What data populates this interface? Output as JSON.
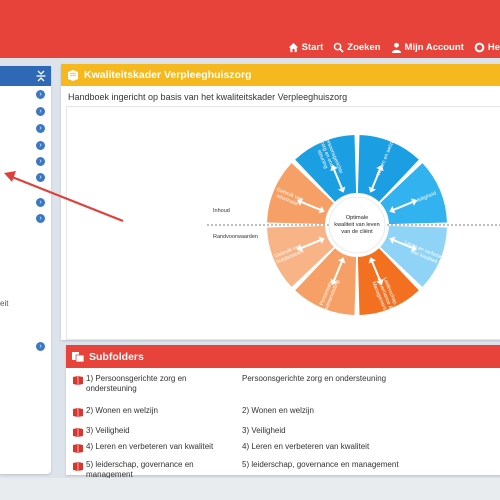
{
  "nav": [
    {
      "label": "Start",
      "icon": "home-icon"
    },
    {
      "label": "Zoeken",
      "icon": "search-icon"
    },
    {
      "label": "Mijn Account",
      "icon": "user-icon"
    },
    {
      "label": "He",
      "icon": "help-lifebuoy-icon"
    }
  ],
  "sidebar": {
    "partial_text": "eit"
  },
  "main": {
    "title": "Kwaliteitskader Verpleeghuiszorg",
    "subtitle": "Handboek ingericht op basis van het kwaliteitskader Verpleeghuiszorg",
    "diagram": {
      "center_text": [
        "Optimale",
        "kwaliteit van leven",
        "van de cliënt"
      ],
      "inhoud_label": "Inhoud",
      "rand_label": "Randvoorwaarden",
      "segments": [
        {
          "lines": [
            "Wonen en welzijn"
          ],
          "color": "#1b9fe2"
        },
        {
          "lines": [
            "Veiligheid"
          ],
          "color": "#33b2f0"
        },
        {
          "lines": [
            "Leren en verbeteren",
            "van kwaliteit"
          ],
          "color": "#8fd3f6"
        },
        {
          "lines": [
            "Leiderschap,",
            "Governance &",
            "Management"
          ],
          "color": "#f2701f"
        },
        {
          "lines": [
            "Personeels-",
            "samenstelling"
          ],
          "color": "#f6a067"
        },
        {
          "lines": [
            "Gebruik van",
            "hulpbronnen"
          ],
          "color": "#f8b487"
        },
        {
          "lines": [
            "Gebruik van",
            "informatie"
          ],
          "color": "#f6a067"
        },
        {
          "lines": [
            "Persoonsgerichte",
            "zorg en onder-",
            "steuning"
          ],
          "color": "#1b9fe2"
        }
      ]
    }
  },
  "subfolders": {
    "title": "Subfolders",
    "rows": [
      {
        "link": "1) Persoonsgerichte zorg en ondersteuning",
        "description": "Persoonsgerichte zorg en ondersteuning"
      },
      {
        "link": "2) Wonen en welzijn",
        "description": "2) Wonen en welzijn"
      },
      {
        "link": "3) Veiligheid",
        "description": "3) Veiligheid"
      },
      {
        "link": "4) Leren en verbeteren van kwaliteit",
        "description": "4) Leren en verbeteren van kwaliteit"
      },
      {
        "link": "5) leiderschap, governance en management",
        "description": "5) leiderschap, governance en management"
      }
    ]
  },
  "colors": {
    "topbar": "#e8433a",
    "sidebar_header": "#2f69b6",
    "main_header": "#f5b81f",
    "subfolder_header": "#e8433a",
    "annotation_arrow": "#e0403a"
  }
}
